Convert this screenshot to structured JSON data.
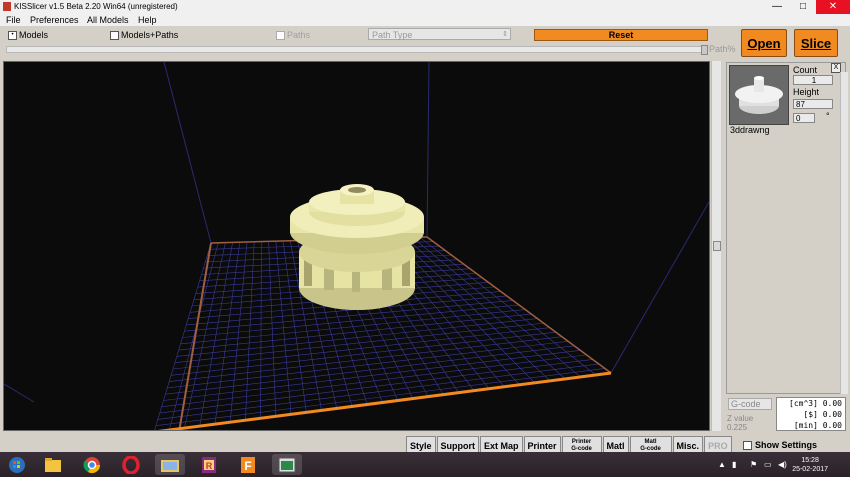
{
  "window": {
    "title": "KISSlicer v1.5 Beta 2.20 Win64 (unregistered)",
    "minimize": "—",
    "maximize": "□",
    "close": "✕"
  },
  "menu": {
    "items": [
      "File",
      "Preferences",
      "All Models",
      "Help"
    ]
  },
  "toolbar": {
    "models_label": "Models",
    "models_paths_label": "Models+Paths",
    "paths_label": "Paths",
    "path_type_value": "Path Type",
    "reset_label": "Reset",
    "path_pct_label": "Path%",
    "open_label": "Open",
    "slice_label": "Slice"
  },
  "model_panel": {
    "count_label": "Count",
    "count_value": "1",
    "height_label": "Height",
    "height_value": "87",
    "rotation_value": "0",
    "degree_symbol": "°",
    "model_name": "3ddrawng",
    "close_label": "X"
  },
  "stats": {
    "gcode_value": "G-code",
    "lines": [
      "[cm^3] 0.00",
      "[$] 0.00",
      "[min] 0.00"
    ],
    "z_label": "Z value",
    "z_value": "0.225"
  },
  "tabs": {
    "style": "Style",
    "support": "Support",
    "ext_map": "Ext Map",
    "printer": "Printer",
    "printer_gcode_top": "Printer",
    "printer_gcode_bottom": "G-code",
    "matl": "Matl",
    "matl_gcode_top": "Matl",
    "matl_gcode_bottom": "G-code",
    "misc": "Misc.",
    "pro": "PRO",
    "show_settings": "Show Settings"
  },
  "taskbar": {
    "time": "15:28",
    "date": "25-02-2017"
  },
  "colors": {
    "accent_orange": "#f28a22",
    "model": "#e6e3a3",
    "grid": "#3a3a9a",
    "bed_edge": "#f28a22"
  }
}
